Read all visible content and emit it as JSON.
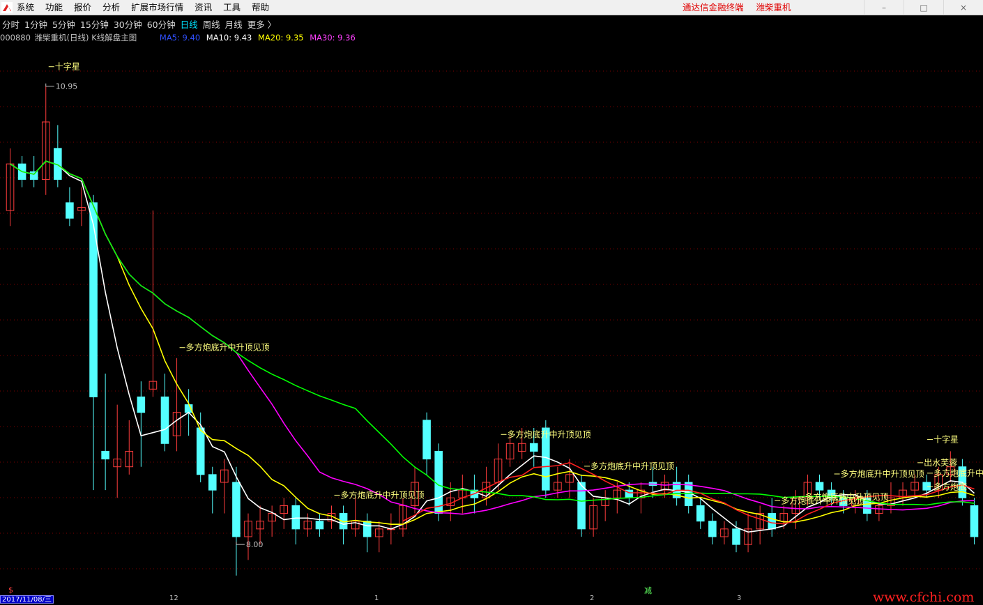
{
  "menu": {
    "items": [
      "系统",
      "功能",
      "报价",
      "分析",
      "扩展市场行情",
      "资讯",
      "工具",
      "帮助"
    ],
    "brand_app": "通达信金融终端",
    "brand_stock": "潍柴重机"
  },
  "periods": {
    "tabs": [
      "分时",
      "1分钟",
      "5分钟",
      "15分钟",
      "30分钟",
      "60分钟",
      "日线",
      "周线",
      "月线",
      "更多 〉"
    ],
    "active_index": 6
  },
  "info": {
    "code": "000880",
    "title": "潍柴重机(日线) K线解盘主图",
    "ma5": "MA5: 9.40",
    "ma10": "MA10: 9.43",
    "ma20": "MA20: 9.35",
    "ma30": "MA30: 9.36"
  },
  "colors": {
    "ma5": "#ffffff",
    "ma10": "#ffff00",
    "ma20": "#ff00ff",
    "ma30": "#00ff00",
    "ma5_label": "#3050ff",
    "ma10_label": "#ffffff",
    "ma20_label": "#ffff00",
    "ma30_label": "#ff40ff",
    "up": "#ff3c3c",
    "down": "#54ffff",
    "grid": "#800000",
    "label": "#ffff80"
  },
  "axis": {
    "date_label": "2017/11/08/三",
    "ticks": [
      "12",
      "1",
      "2",
      "3"
    ]
  },
  "extras": {
    "dollar": "$",
    "jian": "减",
    "watermark": "www.cfchi.com"
  },
  "chart_data": {
    "type": "candlestick",
    "ylim": [
      7.7,
      11.2
    ],
    "high_label": "10.95",
    "low_label": "8.00",
    "high": 10.95,
    "low": 8.0,
    "candles": [
      {
        "o": 10.15,
        "c": 10.45,
        "h": 10.55,
        "l": 10.05
      },
      {
        "o": 10.45,
        "c": 10.35,
        "h": 10.5,
        "l": 10.3
      },
      {
        "o": 10.4,
        "c": 10.35,
        "h": 10.5,
        "l": 10.3
      },
      {
        "o": 10.35,
        "c": 10.72,
        "h": 10.95,
        "l": 10.25
      },
      {
        "o": 10.55,
        "c": 10.35,
        "h": 10.7,
        "l": 10.3
      },
      {
        "o": 10.2,
        "c": 10.1,
        "h": 10.3,
        "l": 10.05
      },
      {
        "o": 10.15,
        "c": 10.17,
        "h": 10.3,
        "l": 10.05
      },
      {
        "o": 10.2,
        "c": 8.95,
        "h": 10.25,
        "l": 8.35
      },
      {
        "o": 8.6,
        "c": 8.55,
        "h": 9.1,
        "l": 8.35
      },
      {
        "o": 8.5,
        "c": 8.55,
        "h": 8.9,
        "l": 8.3
      },
      {
        "o": 8.5,
        "c": 8.6,
        "h": 8.8,
        "l": 8.45
      },
      {
        "o": 8.95,
        "c": 8.85,
        "h": 9.05,
        "l": 8.5
      },
      {
        "o": 9.0,
        "c": 9.05,
        "h": 10.15,
        "l": 8.95
      },
      {
        "o": 8.95,
        "c": 8.65,
        "h": 9.1,
        "l": 8.6
      },
      {
        "o": 8.7,
        "c": 8.85,
        "h": 9.2,
        "l": 8.6
      },
      {
        "o": 8.9,
        "c": 8.85,
        "h": 9.0,
        "l": 8.7
      },
      {
        "o": 8.75,
        "c": 8.45,
        "h": 8.85,
        "l": 8.4
      },
      {
        "o": 8.45,
        "c": 8.35,
        "h": 8.5,
        "l": 8.2
      },
      {
        "o": 8.4,
        "c": 8.48,
        "h": 8.55,
        "l": 8.2
      },
      {
        "o": 8.4,
        "c": 8.05,
        "h": 8.5,
        "l": 7.8
      },
      {
        "o": 8.05,
        "c": 8.15,
        "h": 8.2,
        "l": 7.9
      },
      {
        "o": 8.1,
        "c": 8.15,
        "h": 8.25,
        "l": 8.0
      },
      {
        "o": 8.15,
        "c": 8.2,
        "h": 8.25,
        "l": 8.05
      },
      {
        "o": 8.2,
        "c": 8.25,
        "h": 8.3,
        "l": 8.1
      },
      {
        "o": 8.25,
        "c": 8.1,
        "h": 8.3,
        "l": 8.0
      },
      {
        "o": 8.1,
        "c": 8.15,
        "h": 8.2,
        "l": 8.05
      },
      {
        "o": 8.15,
        "c": 8.1,
        "h": 8.2,
        "l": 8.05
      },
      {
        "o": 8.15,
        "c": 8.2,
        "h": 8.25,
        "l": 8.1
      },
      {
        "o": 8.2,
        "c": 8.1,
        "h": 8.25,
        "l": 8.0
      },
      {
        "o": 8.1,
        "c": 8.15,
        "h": 8.3,
        "l": 8.05
      },
      {
        "o": 8.15,
        "c": 8.05,
        "h": 8.2,
        "l": 7.95
      },
      {
        "o": 8.05,
        "c": 8.1,
        "h": 8.15,
        "l": 7.95
      },
      {
        "o": 8.1,
        "c": 8.1,
        "h": 8.2,
        "l": 8.0
      },
      {
        "o": 8.1,
        "c": 8.25,
        "h": 8.3,
        "l": 8.05
      },
      {
        "o": 8.25,
        "c": 8.4,
        "h": 8.5,
        "l": 8.2
      },
      {
        "o": 8.8,
        "c": 8.55,
        "h": 8.85,
        "l": 8.45
      },
      {
        "o": 8.6,
        "c": 8.2,
        "h": 8.65,
        "l": 8.15
      },
      {
        "o": 8.25,
        "c": 8.3,
        "h": 8.4,
        "l": 8.15
      },
      {
        "o": 8.3,
        "c": 8.35,
        "h": 8.45,
        "l": 8.2
      },
      {
        "o": 8.35,
        "c": 8.3,
        "h": 8.45,
        "l": 8.2
      },
      {
        "o": 8.3,
        "c": 8.4,
        "h": 8.5,
        "l": 8.25
      },
      {
        "o": 8.4,
        "c": 8.55,
        "h": 8.65,
        "l": 8.35
      },
      {
        "o": 8.55,
        "c": 8.65,
        "h": 8.7,
        "l": 8.5
      },
      {
        "o": 8.6,
        "c": 8.65,
        "h": 8.75,
        "l": 8.55
      },
      {
        "o": 8.65,
        "c": 8.6,
        "h": 8.75,
        "l": 8.5
      },
      {
        "o": 8.75,
        "c": 8.35,
        "h": 8.8,
        "l": 8.3
      },
      {
        "o": 8.35,
        "c": 8.4,
        "h": 8.5,
        "l": 8.3
      },
      {
        "o": 8.4,
        "c": 8.45,
        "h": 8.55,
        "l": 8.3
      },
      {
        "o": 8.4,
        "c": 8.1,
        "h": 8.45,
        "l": 8.05
      },
      {
        "o": 8.1,
        "c": 8.25,
        "h": 8.3,
        "l": 8.05
      },
      {
        "o": 8.25,
        "c": 8.3,
        "h": 8.35,
        "l": 8.15
      },
      {
        "o": 8.3,
        "c": 8.35,
        "h": 8.4,
        "l": 8.2
      },
      {
        "o": 8.35,
        "c": 8.3,
        "h": 8.4,
        "l": 8.25
      },
      {
        "o": 8.3,
        "c": 8.35,
        "h": 8.4,
        "l": 8.2
      },
      {
        "o": 8.4,
        "c": 8.38,
        "h": 8.5,
        "l": 8.3
      },
      {
        "o": 8.35,
        "c": 8.4,
        "h": 8.45,
        "l": 8.3
      },
      {
        "o": 8.4,
        "c": 8.3,
        "h": 8.5,
        "l": 8.25
      },
      {
        "o": 8.4,
        "c": 8.25,
        "h": 8.45,
        "l": 8.2
      },
      {
        "o": 8.25,
        "c": 8.15,
        "h": 8.3,
        "l": 8.1
      },
      {
        "o": 8.15,
        "c": 8.05,
        "h": 8.2,
        "l": 8.0
      },
      {
        "o": 8.05,
        "c": 8.1,
        "h": 8.15,
        "l": 8.0
      },
      {
        "o": 8.1,
        "c": 8.0,
        "h": 8.15,
        "l": 7.95
      },
      {
        "o": 8.0,
        "c": 8.1,
        "h": 8.2,
        "l": 7.95
      },
      {
        "o": 8.1,
        "c": 8.2,
        "h": 8.25,
        "l": 8.0
      },
      {
        "o": 8.2,
        "c": 8.1,
        "h": 8.3,
        "l": 8.05
      },
      {
        "o": 8.15,
        "c": 8.2,
        "h": 8.25,
        "l": 8.1
      },
      {
        "o": 8.2,
        "c": 8.3,
        "h": 8.35,
        "l": 8.1
      },
      {
        "o": 8.3,
        "c": 8.4,
        "h": 8.45,
        "l": 8.25
      },
      {
        "o": 8.4,
        "c": 8.35,
        "h": 8.45,
        "l": 8.3
      },
      {
        "o": 8.35,
        "c": 8.3,
        "h": 8.4,
        "l": 8.25
      },
      {
        "o": 8.3,
        "c": 8.25,
        "h": 8.35,
        "l": 8.2
      },
      {
        "o": 8.25,
        "c": 8.3,
        "h": 8.35,
        "l": 8.2
      },
      {
        "o": 8.3,
        "c": 8.2,
        "h": 8.35,
        "l": 8.15
      },
      {
        "o": 8.2,
        "c": 8.25,
        "h": 8.3,
        "l": 8.15
      },
      {
        "o": 8.25,
        "c": 8.3,
        "h": 8.4,
        "l": 8.2
      },
      {
        "o": 8.3,
        "c": 8.35,
        "h": 8.4,
        "l": 8.25
      },
      {
        "o": 8.35,
        "c": 8.4,
        "h": 8.45,
        "l": 8.3
      },
      {
        "o": 8.4,
        "c": 8.35,
        "h": 8.45,
        "l": 8.3
      },
      {
        "o": 8.35,
        "c": 8.45,
        "h": 8.5,
        "l": 8.3
      },
      {
        "o": 8.45,
        "c": 8.5,
        "h": 8.6,
        "l": 8.4
      },
      {
        "o": 8.5,
        "c": 8.3,
        "h": 8.55,
        "l": 8.25
      },
      {
        "o": 8.25,
        "c": 8.05,
        "h": 8.3,
        "l": 8.0
      }
    ],
    "annotations": [
      {
        "text": "十字星"
      },
      {
        "text": "多方炮底升中升顶见顶"
      },
      {
        "text": "多方炮底升中升顶见顶"
      },
      {
        "text": "多方炮底升中升顶见顶"
      },
      {
        "text": "多方炮底升中升顶见顶"
      },
      {
        "text": "多方炮底升中升顶见顶"
      },
      {
        "text": "多方炮底升中升顶见顶"
      },
      {
        "text": "多方炮底升中升顶见顶"
      },
      {
        "text": "出水芙蓉"
      },
      {
        "text": "十字星"
      },
      {
        "text": "多方炮底升中升顶见顶"
      },
      {
        "text": "多方炮底"
      }
    ]
  }
}
